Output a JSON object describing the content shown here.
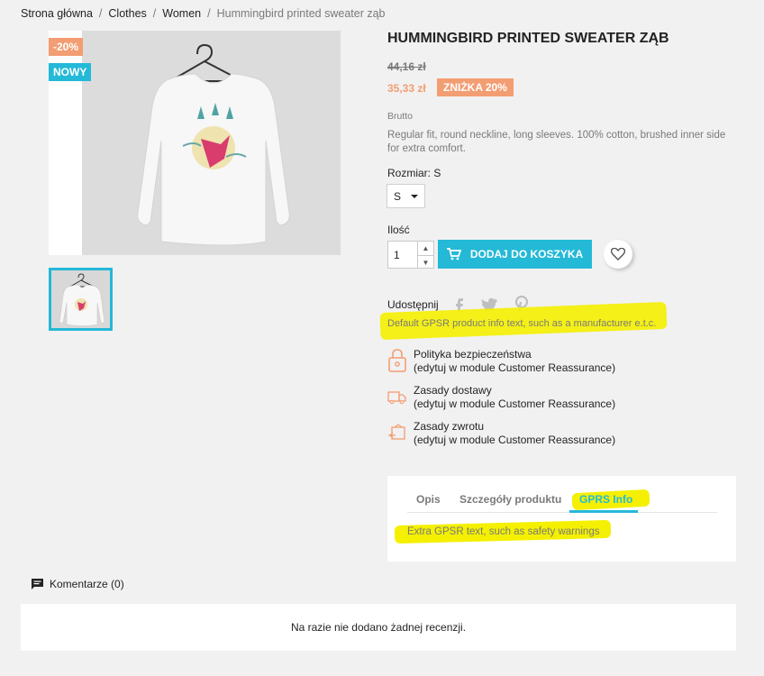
{
  "breadcrumb": [
    {
      "label": "Strona główna"
    },
    {
      "label": "Clothes"
    },
    {
      "label": "Women"
    },
    {
      "label": "Hummingbird printed sweater ząb"
    }
  ],
  "breadcrumb_separator": "/",
  "badges": {
    "discount": "-20%",
    "new": "NOWY"
  },
  "product": {
    "title": "Hummingbird printed sweater ząb",
    "old_price": "44,16 zł",
    "new_price": "35,33 zł",
    "discount_label": "ZNIŻKA 20%",
    "tax_label": "Brutto",
    "description": "Regular fit, round neckline, long sleeves. 100% cotton, brushed inner side for extra comfort.",
    "size_label": "Rozmiar: S",
    "size_value": "S",
    "quantity_label": "Ilość",
    "quantity_value": "1",
    "add_to_cart": "Dodaj do koszyka"
  },
  "share": {
    "label": "Udostępnij",
    "networks": [
      "facebook-icon",
      "twitter-icon",
      "pinterest-icon"
    ]
  },
  "gpsr_text": "Default GPSR product info text, such as a manufacturer e.t.c.",
  "reassurance": [
    {
      "icon": "lock-icon",
      "title": "Polityka bezpieczeństwa",
      "subtitle": "(edytuj w module Customer Reassurance)"
    },
    {
      "icon": "truck-icon",
      "title": "Zasady dostawy",
      "subtitle": "(edytuj w module Customer Reassurance)"
    },
    {
      "icon": "return-icon",
      "title": "Zasady zwrotu",
      "subtitle": "(edytuj w module Customer Reassurance)"
    }
  ],
  "tabs": {
    "items": [
      {
        "label": "Opis"
      },
      {
        "label": "Szczegóły produktu"
      },
      {
        "label": "GPRS Info"
      }
    ],
    "active_index": 2,
    "content": "Extra GPSR text, such as safety warnings"
  },
  "comments": {
    "title": "Komentarze (0)",
    "empty_text": "Na razie nie dodano żadnej recenzji."
  },
  "colors": {
    "accent": "#24b9d7",
    "discount": "#f39d72",
    "highlight": "#f4f000",
    "background": "#f1f1f1"
  }
}
